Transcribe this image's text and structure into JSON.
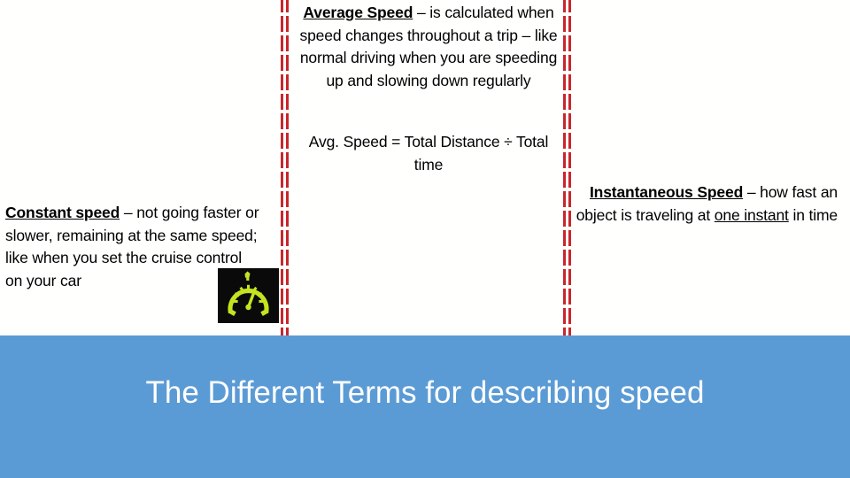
{
  "slide": {
    "background_color": "#FFFFFE",
    "banner": {
      "title": "The Different Terms for describing speed",
      "background_color": "#5B9BD5",
      "text_color": "#FFFFFF"
    },
    "divider": {
      "color": "#C8262C",
      "style": "dashed-double-vertical"
    }
  },
  "blocks": {
    "average_speed": {
      "term": "Average Speed",
      "dash": " – ",
      "definition": "is calculated when speed changes throughout a trip – like normal driving when you are speeding up and slowing down regularly"
    },
    "formula": {
      "text": "Avg. Speed = Total Distance ÷ Total time"
    },
    "constant_speed": {
      "term": "Constant speed",
      "dash": " – ",
      "definition": "not going faster or slower, remaining at the same speed; like when you set the cruise control on your car"
    },
    "instantaneous_speed": {
      "term": "Instantaneous Speed",
      "dash": " – ",
      "definition_part1": "how fast an object is traveling at ",
      "definition_emphasis": "one instant",
      "definition_part2": " in time"
    }
  },
  "icons": {
    "speedometer": {
      "name": "speedometer-icon",
      "face_color": "#C3E520",
      "background_color": "#0A0A0A"
    }
  }
}
